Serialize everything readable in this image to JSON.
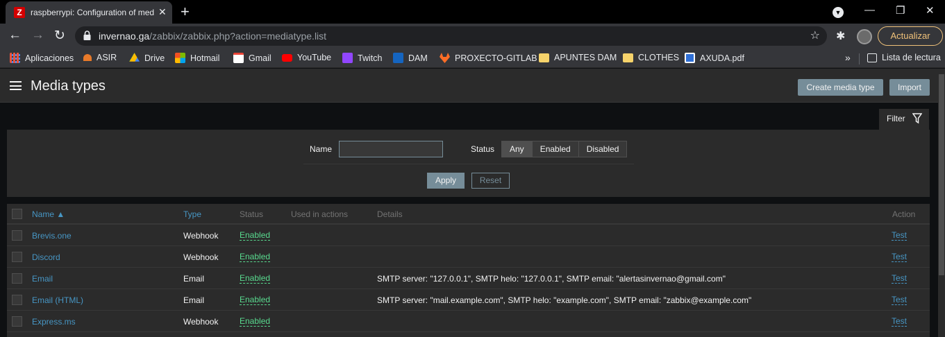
{
  "browser": {
    "tab_title": "raspberrypi: Configuration of media types",
    "favicon_letter": "Z",
    "url_host": "invernao.ga",
    "url_path": "/zabbix/zabbix.php?action=mediatype.list",
    "update_label": "Actualizar",
    "bookmarks": [
      {
        "label": "Aplicaciones",
        "icon": "apps-grid-icon",
        "color": "#e8543e"
      },
      {
        "label": "ASIR",
        "icon": "asir-icon",
        "color": "#e87a2a"
      },
      {
        "label": "Drive",
        "icon": "drive-icon",
        "color": "#34a853"
      },
      {
        "label": "Hotmail",
        "icon": "hotmail-icon",
        "color": "#f35325"
      },
      {
        "label": "Gmail",
        "icon": "gmail-icon",
        "color": "#ea4335"
      },
      {
        "label": "YouTube",
        "icon": "youtube-icon",
        "color": "#ff0000"
      },
      {
        "label": "Twitch",
        "icon": "twitch-icon",
        "color": "#9146ff"
      },
      {
        "label": "DAM",
        "icon": "fp-icon",
        "color": "#1565c0"
      },
      {
        "label": "PROXECTO-GITLAB",
        "icon": "gitlab-icon",
        "color": "#fc6d26"
      },
      {
        "label": "APUNTES DAM",
        "icon": "folder-icon",
        "color": "#f6d36b"
      },
      {
        "label": "CLOTHES",
        "icon": "folder-icon",
        "color": "#f6d36b"
      },
      {
        "label": "AXUDA.pdf",
        "icon": "pdf-icon",
        "color": "#2f6fd6"
      }
    ],
    "reading_list_label": "Lista de lectura"
  },
  "header": {
    "title": "Media types",
    "create_label": "Create media type",
    "import_label": "Import"
  },
  "filter": {
    "tab_label": "Filter",
    "name_label": "Name",
    "name_value": "",
    "status_label": "Status",
    "status_options": [
      "Any",
      "Enabled",
      "Disabled"
    ],
    "status_selected": "Any",
    "apply_label": "Apply",
    "reset_label": "Reset"
  },
  "table": {
    "columns": {
      "name": "Name ▲",
      "type": "Type",
      "status": "Status",
      "used": "Used in actions",
      "details": "Details",
      "action": "Action"
    },
    "rows": [
      {
        "name": "Brevis.one",
        "type": "Webhook",
        "status": "Enabled",
        "used": "",
        "details": "",
        "action": "Test"
      },
      {
        "name": "Discord",
        "type": "Webhook",
        "status": "Enabled",
        "used": "",
        "details": "",
        "action": "Test"
      },
      {
        "name": "Email",
        "type": "Email",
        "status": "Enabled",
        "used": "",
        "details": "SMTP server: \"127.0.0.1\", SMTP helo: \"127.0.0.1\", SMTP email: \"alertasinvernao@gmail.com\"",
        "action": "Test"
      },
      {
        "name": "Email (HTML)",
        "type": "Email",
        "status": "Enabled",
        "used": "",
        "details": "SMTP server: \"mail.example.com\", SMTP helo: \"example.com\", SMTP email: \"zabbix@example.com\"",
        "action": "Test"
      },
      {
        "name": "Express.ms",
        "type": "Webhook",
        "status": "Enabled",
        "used": "",
        "details": "",
        "action": "Test"
      }
    ]
  }
}
